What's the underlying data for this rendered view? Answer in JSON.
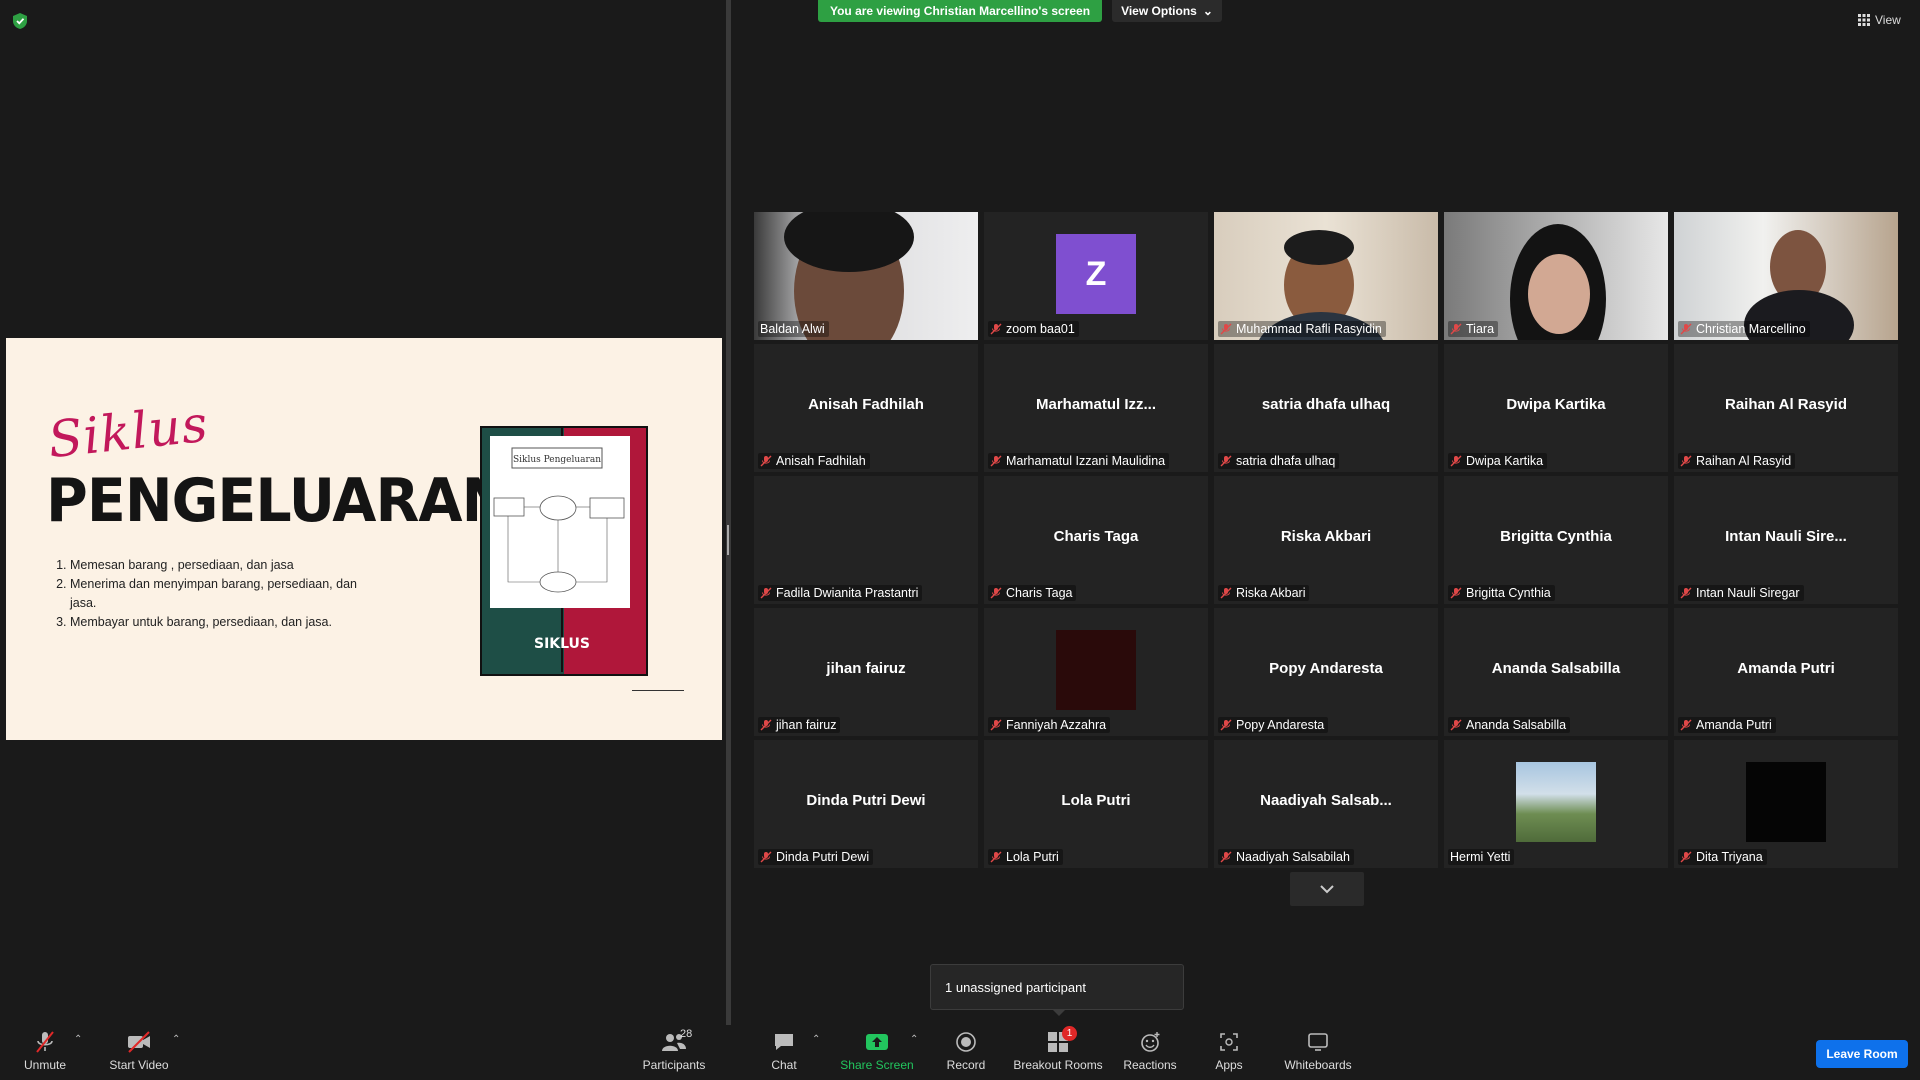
{
  "banner": {
    "viewing": "You are viewing Christian Marcellino's screen",
    "view_options": "View Options",
    "view": "View"
  },
  "slide": {
    "script_word": "Siklus",
    "title": "PENGELUARAN",
    "list": [
      "Memesan barang , persediaan, dan jasa",
      "Menerima dan menyimpan barang, persediaan, dan jasa.",
      "Membayar untuk barang, persediaan, dan jasa."
    ],
    "book_label": "SIKLUS",
    "book_page_title": "Siklus Pengeluaran"
  },
  "participants": [
    {
      "label": "Baldan Alwi",
      "center": "",
      "kind": "video-1",
      "muted": false,
      "active": true
    },
    {
      "label": "zoom baa01",
      "center": "",
      "kind": "avatar-z",
      "avatar": "Z",
      "muted": true
    },
    {
      "label": "Muhammad Rafli Rasyidin",
      "center": "",
      "kind": "video-2",
      "muted": true
    },
    {
      "label": "Tiara",
      "center": "",
      "kind": "video-3",
      "muted": true
    },
    {
      "label": "Christian Marcellino",
      "center": "",
      "kind": "video-4",
      "muted": true
    },
    {
      "label": "Anisah Fadhilah",
      "center": "Anisah Fadhilah",
      "muted": true
    },
    {
      "label": "Marhamatul Izzani Maulidina",
      "center": "Marhamatul  Izz...",
      "muted": true
    },
    {
      "label": "satria dhafa ulhaq",
      "center": "satria dhafa ulhaq",
      "muted": true
    },
    {
      "label": "Dwipa Kartika",
      "center": "Dwipa Kartika",
      "muted": true
    },
    {
      "label": "Raihan Al Rasyid",
      "center": "Raihan Al Rasyid",
      "muted": true
    },
    {
      "label": "Fadila Dwianita Prastantri",
      "center": "",
      "muted": true
    },
    {
      "label": "Charis Taga",
      "center": "Charis Taga",
      "muted": true
    },
    {
      "label": "Riska Akbari",
      "center": "Riska Akbari",
      "muted": true
    },
    {
      "label": "Brigitta Cynthia",
      "center": "Brigitta Cynthia",
      "muted": true
    },
    {
      "label": "Intan Nauli Siregar",
      "center": "Intan  Nauli  Sire...",
      "muted": true
    },
    {
      "label": "jihan fairuz",
      "center": "jihan fairuz",
      "muted": true
    },
    {
      "label": "Fanniyah Azzahra",
      "center": "",
      "kind": "thumb-dark-red",
      "muted": true
    },
    {
      "label": "Popy Andaresta",
      "center": "Popy Andaresta",
      "muted": true
    },
    {
      "label": "Ananda Salsabilla",
      "center": "Ananda Salsabilla",
      "muted": true
    },
    {
      "label": "Amanda Putri",
      "center": "Amanda Putri",
      "muted": true
    },
    {
      "label": "Dinda Putri Dewi",
      "center": "Dinda Putri Dewi",
      "muted": true
    },
    {
      "label": "Lola Putri",
      "center": "Lola Putri",
      "muted": true
    },
    {
      "label": "Naadiyah Salsabilah",
      "center": "Naadiyah  Salsab...",
      "muted": true
    },
    {
      "label": "Hermi Yetti",
      "center": "",
      "kind": "thumb-photo",
      "muted": false
    },
    {
      "label": "Dita Triyana",
      "center": "",
      "kind": "thumb-black",
      "muted": true
    }
  ],
  "tooltip": "1 unassigned participant",
  "toolbar": {
    "unmute": "Unmute",
    "start_video": "Start Video",
    "participants": "Participants",
    "participants_count": "28",
    "chat": "Chat",
    "share_screen": "Share Screen",
    "record": "Record",
    "breakout_rooms": "Breakout Rooms",
    "breakout_badge": "1",
    "reactions": "Reactions",
    "apps": "Apps",
    "whiteboards": "Whiteboards",
    "leave": "Leave Room"
  },
  "colors": {
    "share_green": "#22c55e",
    "leave_blue": "#0e71eb",
    "muted_red": "#e02828",
    "active_border": "#d4e046"
  }
}
